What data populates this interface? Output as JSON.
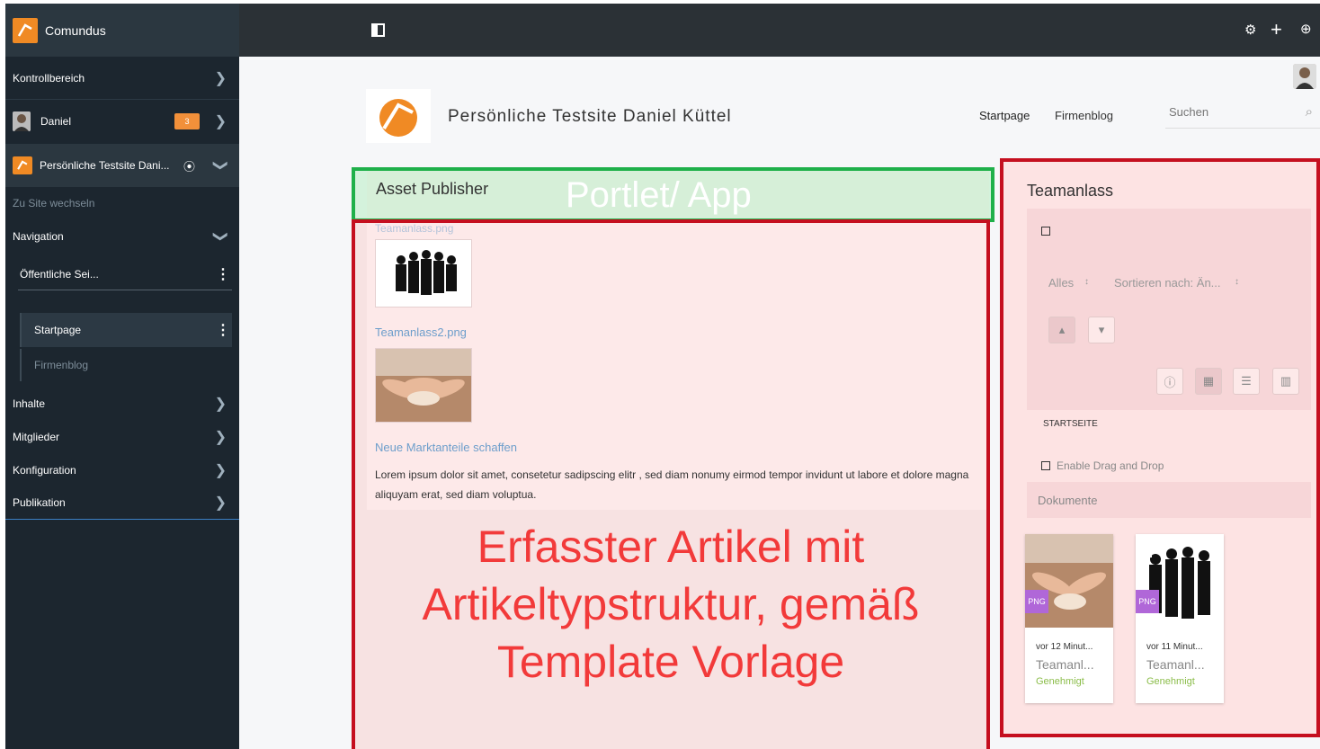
{
  "sidebar": {
    "brand": "Comundus",
    "kontrollbereich": "Kontrollbereich",
    "user": "Daniel",
    "user_badge": "3",
    "site": "Persönliche Testsite Dani...",
    "switch_site": "Zu Site wechseln",
    "navigation": "Navigation",
    "public_pages": "Öffentliche Sei...",
    "pages": [
      {
        "label": "Startpage"
      },
      {
        "label": "Firmenblog"
      }
    ],
    "inhalte": "Inhalte",
    "mitglieder": "Mitglieder",
    "konfiguration": "Konfiguration",
    "publikation": "Publikation"
  },
  "header": {
    "site_title": "Persönliche Testsite Daniel Küttel",
    "nav": [
      "Startpage",
      "Firmenblog"
    ],
    "search_placeholder": "Suchen"
  },
  "asset_publisher": {
    "title": "Asset Publisher",
    "overlay_label": "Portlet/ App",
    "items": [
      {
        "link": "Teamanlass.png"
      },
      {
        "link": "Teamanlass2.png"
      }
    ],
    "article_title": "Neue Marktanteile schaffen",
    "article_body": "Lorem ipsum dolor sit amet, consetetur sadipscing elitr , sed diam nonumy eirmod tempor invidunt ut labore et dolore magna aliquyam erat, sed diam voluptua.",
    "annotation": [
      "Erfasster Artikel mit",
      "Artikeltypstruktur, gemäß",
      "Template Vorlage"
    ]
  },
  "documents_portlet": {
    "title": "Teamanlass",
    "filter": "Alles",
    "sort": "Sortieren nach: Än...",
    "breadcrumb": "STARTSEITE",
    "drag_drop": "Enable Drag and Drop",
    "section": "Dokumente",
    "cards": [
      {
        "type": "PNG",
        "time": "vor 12 Minut...",
        "name": "Teamanl...",
        "status": "Genehmigt"
      },
      {
        "type": "PNG",
        "time": "vor 11 Minut...",
        "name": "Teamanl...",
        "status": "Genehmigt"
      }
    ]
  },
  "colors": {
    "sidebar_bg": "#1c262f",
    "accent_orange": "#f08a24",
    "annotation_red": "#c50f1f",
    "annotation_green": "#1fb04a",
    "status_green": "#8bbd4a"
  }
}
